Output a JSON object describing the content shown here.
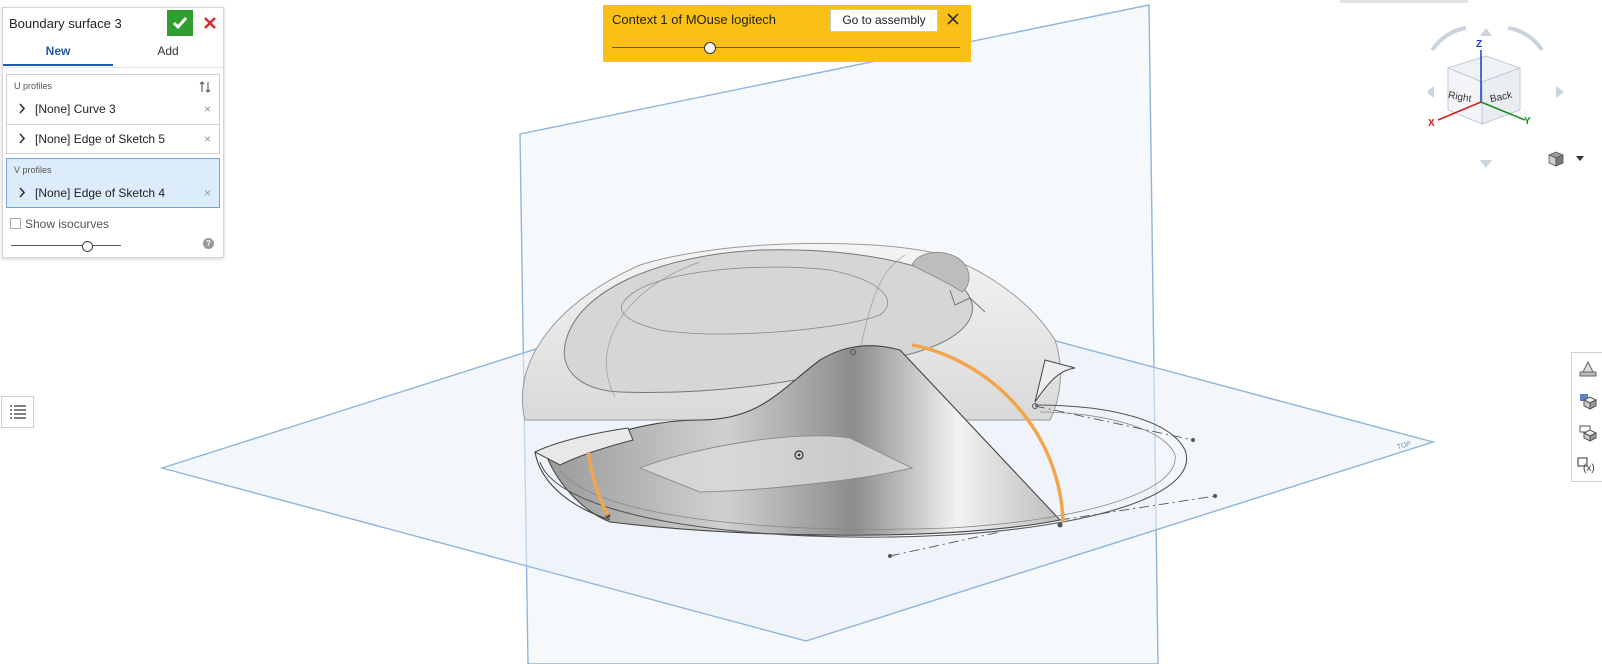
{
  "dialog": {
    "title": "Boundary surface 3",
    "tabs": [
      "New",
      "Add"
    ],
    "u_profiles": {
      "label": "U profiles",
      "items": [
        "[None] Curve 3",
        "[None] Edge of Sketch 5"
      ]
    },
    "v_profiles": {
      "label": "V profiles",
      "items": [
        "[None] Edge of Sketch 4"
      ]
    },
    "show_isocurves_label": "Show isocurves",
    "show_isocurves_checked": false,
    "remove_glyph": "×"
  },
  "context_banner": {
    "title": "Context 1 of MOuse logitech",
    "button_label": "Go to assembly",
    "slider_value": 0.28
  },
  "view_cube": {
    "faces": [
      "Right",
      "Back"
    ],
    "axes": [
      "Z",
      "X",
      "Y"
    ]
  },
  "colors": {
    "banner": "#fbc018",
    "accent": "#1e5ea8",
    "confirm": "#2e9e2e",
    "cancel": "#d32f2f",
    "plane": "#8fb5da",
    "highlight_edge": "#f3a54b",
    "selected_row": "#dcecfa"
  },
  "icons": [
    "check-icon",
    "close-icon",
    "sort-icon",
    "chevron-right-icon",
    "help-icon",
    "list-icon",
    "view-cube",
    "cube-icon",
    "caret-down-icon",
    "render-mode-icon",
    "section-view-icon",
    "named-views-icon",
    "variables-icon"
  ]
}
